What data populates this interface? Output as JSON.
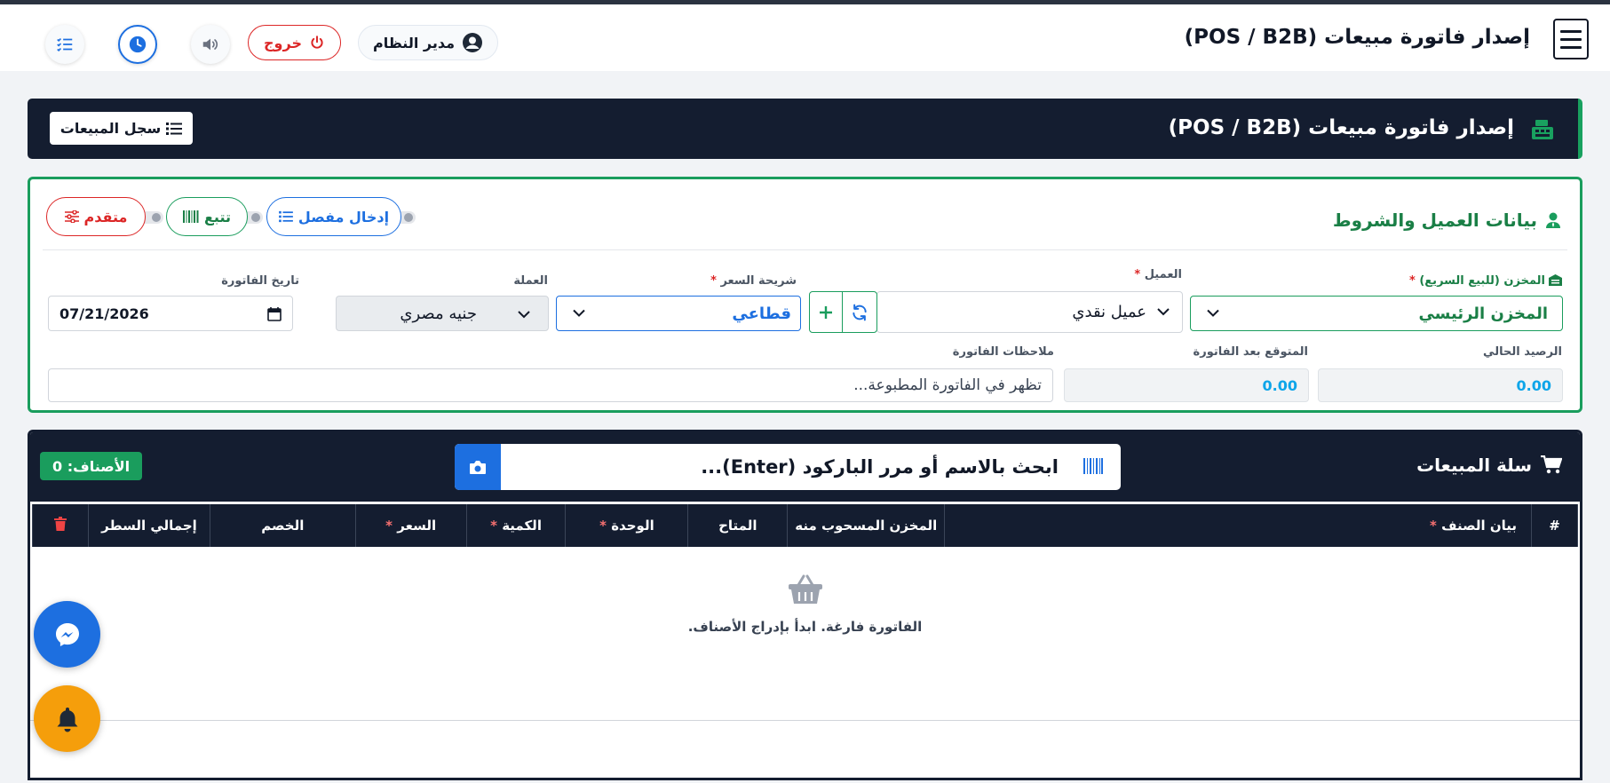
{
  "topbar": {
    "title": "إصدار فاتورة مبيعات (POS / B2B)",
    "user_name": "مدير النظام",
    "logout_label": "خروج"
  },
  "header": {
    "title": "إصدار فاتورة مبيعات (POS / B2B)",
    "sales_log_label": "سجل المبيعات"
  },
  "customer_section": {
    "title": "بيانات العميل والشروط",
    "modes": {
      "detailed": "إدخال مفصل",
      "track": "تتبع",
      "advanced": "متقدم"
    },
    "warehouse_label": "المخزن (للبيع السريع)",
    "warehouse_value": "المخزن الرئيسي",
    "customer_label": "العميل",
    "customer_value": "عميل نقدي",
    "price_tier_label": "شريحة السعر",
    "price_tier_value": "قطاعي",
    "currency_label": "العملة",
    "currency_value": "جنيه مصري",
    "invoice_date_label": "تاريخ الفاتورة",
    "invoice_date_value": "07/21/2026",
    "current_balance_label": "الرصيد الحالي",
    "current_balance_value": "0.00",
    "expected_balance_label": "المتوقع بعد الفاتورة",
    "expected_balance_value": "0.00",
    "notes_label": "ملاحظات الفاتورة",
    "notes_placeholder": "تظهر في الفاتورة المطبوعة..."
  },
  "cart": {
    "title": "سلة المبيعات",
    "search_placeholder": "ابحث بالاسم أو مرر الباركود (Enter)...",
    "items_count_label": "الأصناف: 0",
    "columns": {
      "index": "#",
      "item_desc": "بيان الصنف",
      "source_warehouse": "المخزن المسحوب منه",
      "available": "المتاح",
      "unit": "الوحدة",
      "quantity": "الكمية",
      "price": "السعر",
      "discount": "الخصم",
      "line_total": "إجمالي السطر"
    },
    "empty_text": "الفاتورة فارغة. ابدأ بإدراج الأصناف."
  },
  "colors": {
    "navy": "#141d30",
    "green": "#1a9d5d",
    "blue": "#1d6fe0",
    "red": "#dc2626",
    "amber": "#f59e0b"
  },
  "icons": [
    "menu-icon",
    "user-circle-icon",
    "power-icon",
    "speaker-icon",
    "clock-icon",
    "tasks-icon",
    "cash-register-icon",
    "list-icon",
    "user-tie-icon",
    "barcode-icon",
    "sliders-icon",
    "warehouse-icon",
    "chevron-down-icon",
    "refresh-icon",
    "plus-icon",
    "calendar-icon",
    "cart-icon",
    "camera-icon",
    "trash-icon",
    "basket-icon",
    "messenger-icon",
    "bell-icon"
  ]
}
